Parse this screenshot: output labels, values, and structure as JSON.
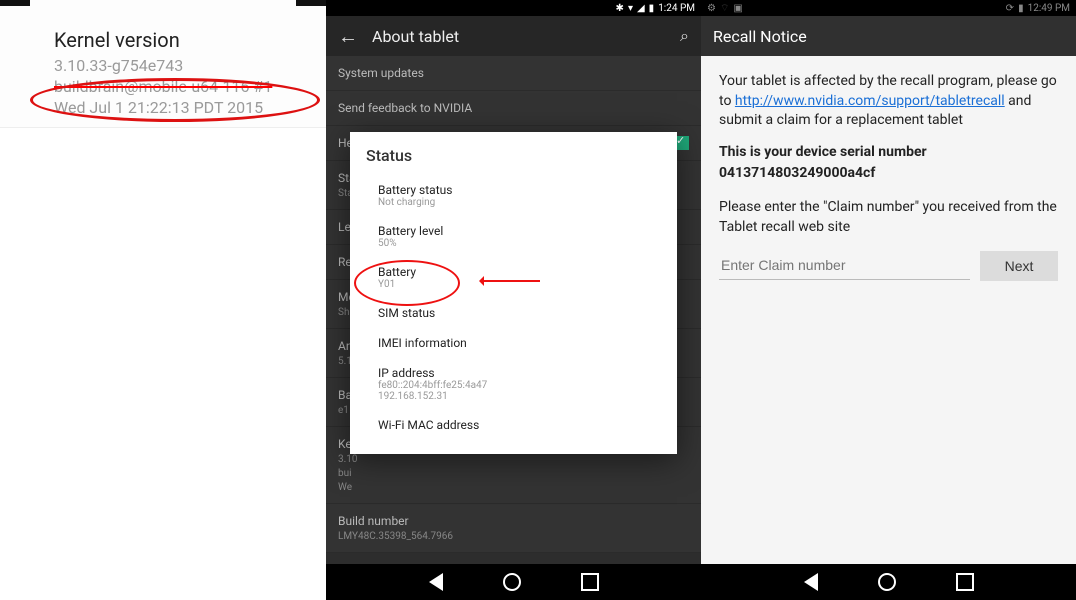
{
  "pane1": {
    "heading": "Kernel version",
    "line1": "3.10.33-g754e743",
    "line2": "buildbrain@mobile-u64-116 #1",
    "line3": "Wed Jul 1 21:22:13 PDT 2015"
  },
  "pane2": {
    "status_time": "1:24 PM",
    "appbar_title": "About tablet",
    "items": [
      "System updates",
      "Send feedback to NVIDIA",
      "Help NVIDIA to improve the SHIELD experience",
      "Sta",
      "Legal information",
      "Regulatory information",
      "Model number",
      "Android version",
      "Baseband version",
      "Kernel version",
      "Build number"
    ],
    "sub_status": "Sta",
    "sub_android": "5.1",
    "sub_baseband": "e1",
    "sub_kernel1": "3.10",
    "sub_kernel2": "bui",
    "sub_build": "LMY48C.35398_564.7966",
    "dialog": {
      "title": "Status",
      "rows": [
        {
          "t": "Battery status",
          "s": "Not charging"
        },
        {
          "t": "Battery level",
          "s": "50%"
        },
        {
          "t": "Battery",
          "s": "Y01"
        },
        {
          "t": "SIM status",
          "s": ""
        },
        {
          "t": "IMEI information",
          "s": ""
        },
        {
          "t": "IP address",
          "s": "fe80::204:4bff:fe25:4a47\n192.168.152.31"
        },
        {
          "t": "Wi-Fi MAC address",
          "s": ""
        }
      ]
    }
  },
  "pane3": {
    "status_time": "12:49 PM",
    "appbar_title": "Recall Notice",
    "body_prefix": "Your tablet is affected by the recall program, please go to ",
    "link_text": "http://www.nvidia.com/support/tabletrecall",
    "body_suffix": " and submit a claim for a replacement tablet",
    "serial_label": "This is your device serial number",
    "serial_value": "0413714803249000a4cf",
    "claim_prompt": "Please enter the \"Claim number\" you received from the Tablet recall web site",
    "claim_placeholder": "Enter Claim number",
    "next_label": "Next"
  }
}
